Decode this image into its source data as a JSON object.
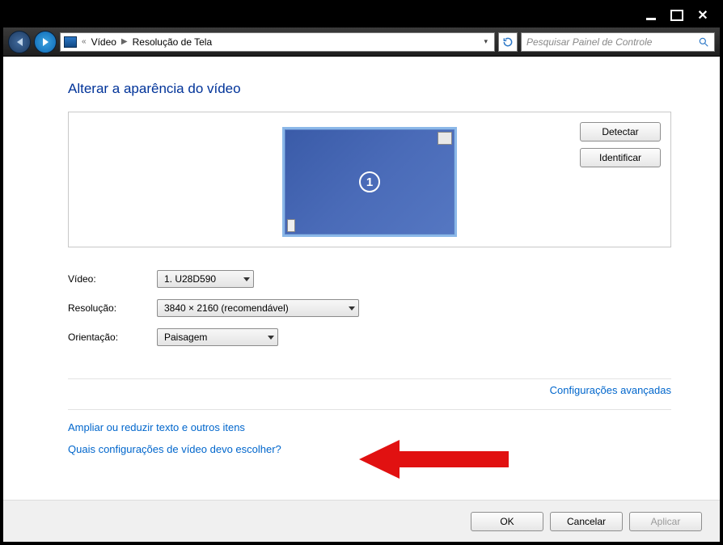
{
  "titlebar": {
    "minimize": "_",
    "maximize": "□",
    "close": "✕"
  },
  "address": {
    "segment1": "Vídeo",
    "segment2": "Resolução de Tela"
  },
  "search": {
    "placeholder": "Pesquisar Painel de Controle"
  },
  "page": {
    "title": "Alterar a aparência do vídeo"
  },
  "preview": {
    "monitor_number": "1",
    "detect_btn": "Detectar",
    "identify_btn": "Identificar"
  },
  "form": {
    "video_label": "Vídeo:",
    "video_value": "1. U28D590",
    "resolution_label": "Resolução:",
    "resolution_value": "3840 × 2160 (recomendável)",
    "orientation_label": "Orientação:",
    "orientation_value": "Paisagem"
  },
  "links": {
    "advanced": "Configurações avançadas",
    "resize_text": "Ampliar ou reduzir texto e outros itens",
    "which_settings": "Quais configurações de vídeo devo escolher?"
  },
  "footer": {
    "ok": "OK",
    "cancel": "Cancelar",
    "apply": "Aplicar"
  }
}
